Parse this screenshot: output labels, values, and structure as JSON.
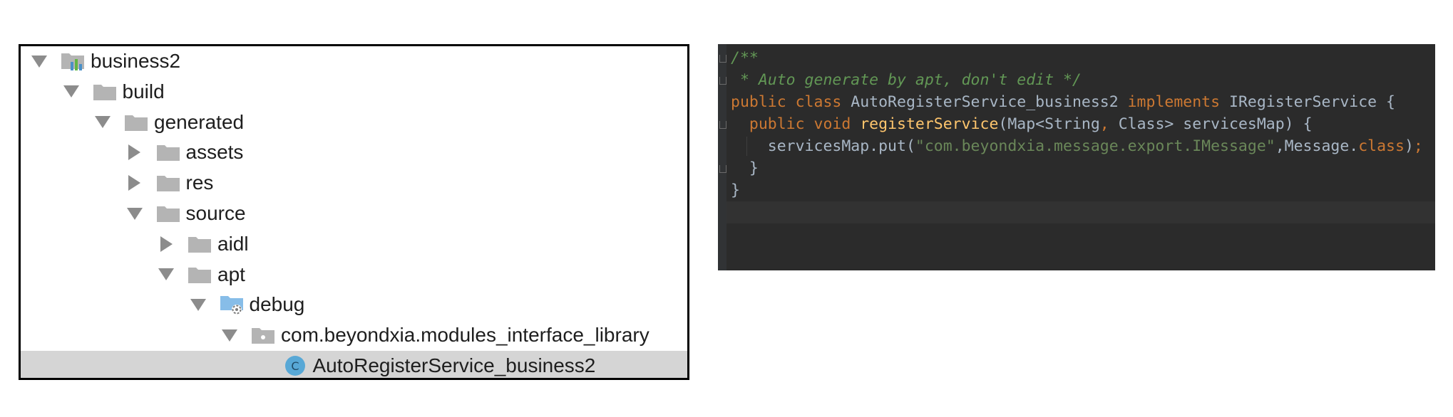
{
  "project_tree": {
    "rows": [
      {
        "label": "business2",
        "depth": 0,
        "arrow": "down",
        "icon": "module-icon"
      },
      {
        "label": "build",
        "depth": 1,
        "arrow": "down",
        "icon": "folder-icon"
      },
      {
        "label": "generated",
        "depth": 2,
        "arrow": "down",
        "icon": "folder-icon"
      },
      {
        "label": "assets",
        "depth": 3,
        "arrow": "right",
        "icon": "folder-icon"
      },
      {
        "label": "res",
        "depth": 3,
        "arrow": "right",
        "icon": "folder-icon"
      },
      {
        "label": "source",
        "depth": 3,
        "arrow": "down",
        "icon": "folder-icon"
      },
      {
        "label": "aidl",
        "depth": 4,
        "arrow": "right",
        "icon": "folder-icon"
      },
      {
        "label": "apt",
        "depth": 4,
        "arrow": "down",
        "icon": "folder-icon"
      },
      {
        "label": "debug",
        "depth": 5,
        "arrow": "down",
        "icon": "source-root-folder-icon"
      },
      {
        "label": "com.beyondxia.modules_interface_library",
        "depth": 6,
        "arrow": "down",
        "icon": "package-icon"
      },
      {
        "label": "AutoRegisterService_business2",
        "depth": 7,
        "arrow": "none",
        "icon": "class-icon",
        "selected": true
      }
    ]
  },
  "code_editor": {
    "lines": [
      {
        "tokens": [
          {
            "t": "comment",
            "v": "/**"
          }
        ]
      },
      {
        "tokens": [
          {
            "t": "comment",
            "v": " * Auto generate by apt, don't edit */"
          }
        ]
      },
      {
        "tokens": [
          {
            "t": "kw",
            "v": "public class "
          },
          {
            "t": "plain",
            "v": "AutoRegisterService_business2 "
          },
          {
            "t": "kw",
            "v": "implements "
          },
          {
            "t": "plain",
            "v": "IRegisterService {"
          }
        ]
      },
      {
        "tokens": [
          {
            "t": "plain",
            "v": "  "
          },
          {
            "t": "kw",
            "v": "public void "
          },
          {
            "t": "fn",
            "v": "registerService"
          },
          {
            "t": "plain",
            "v": "(Map<String"
          },
          {
            "t": "kw",
            "v": ", "
          },
          {
            "t": "plain",
            "v": "Class> servicesMap) {"
          }
        ]
      },
      {
        "tokens": [
          {
            "t": "plain",
            "v": "    servicesMap.put("
          },
          {
            "t": "str",
            "v": "\"com.beyondxia.message.export.IMessage\""
          },
          {
            "t": "plain",
            "v": ",Message."
          },
          {
            "t": "kw",
            "v": "class"
          },
          {
            "t": "plain",
            "v": ")"
          },
          {
            "t": "kw",
            "v": ";"
          }
        ]
      },
      {
        "tokens": [
          {
            "t": "plain",
            "v": "  }"
          }
        ]
      },
      {
        "tokens": [
          {
            "t": "plain",
            "v": "}"
          }
        ]
      },
      {
        "tokens": [
          {
            "t": "plain",
            "v": ""
          }
        ]
      }
    ],
    "colors": {
      "background": "#2b2b2b",
      "comment": "#629755",
      "keyword": "#cc7832",
      "function": "#ffc66d",
      "string": "#6a8759",
      "plain": "#a9b7c6"
    }
  }
}
